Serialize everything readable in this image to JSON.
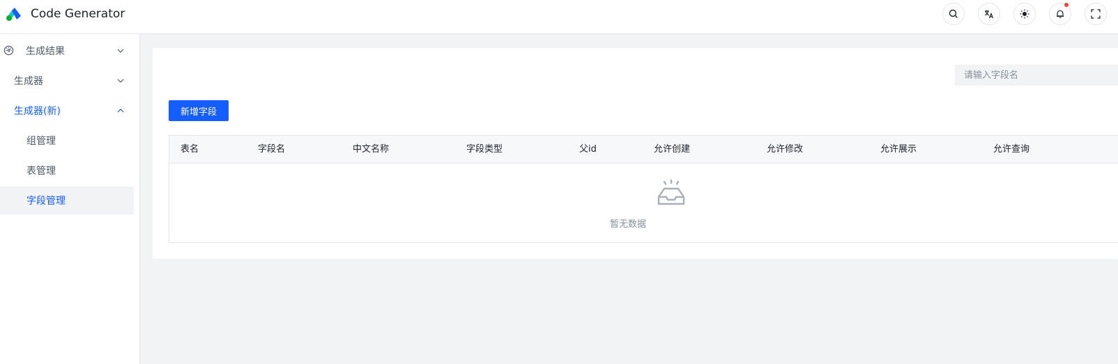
{
  "app": {
    "title": "Code Generator",
    "accent_color": "#165dff",
    "logo_icon": "app-logo-icon"
  },
  "header": {
    "actions": [
      {
        "name": "search-icon"
      },
      {
        "name": "translate-icon"
      },
      {
        "name": "theme-toggle-icon"
      },
      {
        "name": "notification-bell-icon",
        "has_badge": true
      },
      {
        "name": "fullscreen-icon"
      }
    ]
  },
  "sidebar": {
    "items": [
      {
        "label": "生成结果",
        "icon": "dashboard-icon",
        "expandable": true,
        "expanded": false
      },
      {
        "label": "生成器",
        "expandable": true,
        "expanded": false
      },
      {
        "label": "生成器(新)",
        "expandable": true,
        "expanded": true,
        "active": true
      },
      {
        "label": "组管理",
        "child": true
      },
      {
        "label": "表管理",
        "child": true
      },
      {
        "label": "字段管理",
        "child": true,
        "selected": true
      }
    ]
  },
  "main": {
    "search": {
      "placeholder": "请输入字段名",
      "value": ""
    },
    "add_button_label": "新增字段",
    "table": {
      "columns": [
        "表名",
        "字段名",
        "中文名称",
        "字段类型",
        "父id",
        "允许创建",
        "允许修改",
        "允许展示",
        "允许查询"
      ],
      "rows": [],
      "empty_text": "暂无数据"
    }
  }
}
